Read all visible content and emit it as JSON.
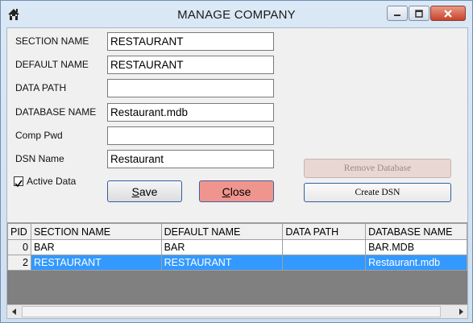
{
  "window": {
    "title": "MANAGE COMPANY",
    "icon": "house-icon"
  },
  "form": {
    "section_name": {
      "label": "SECTION NAME",
      "value": "RESTAURANT"
    },
    "default_name": {
      "label": "DEFAULT NAME",
      "value": "RESTAURANT"
    },
    "data_path": {
      "label": "DATA PATH",
      "value": ""
    },
    "database_name": {
      "label": "DATABASE NAME",
      "value": "Restaurant.mdb"
    },
    "comp_pwd": {
      "label": "Comp Pwd",
      "value": ""
    },
    "dsn_name": {
      "label": "DSN Name",
      "value": "Restaurant"
    },
    "active_data": {
      "label": "Active Data",
      "checked": true
    }
  },
  "buttons": {
    "save": {
      "label_first": "S",
      "label_rest": "ave"
    },
    "close": {
      "label_first": "C",
      "label_rest": "lose"
    },
    "remove_database": "Remove Database",
    "create_dsn": "Create DSN"
  },
  "grid": {
    "columns": [
      "PID",
      "SECTION NAME",
      "DEFAULT NAME",
      "DATA PATH",
      "DATABASE NAME"
    ],
    "rows": [
      {
        "pid": "0",
        "section": "BAR",
        "default": "BAR",
        "path": "",
        "db": "BAR.MDB",
        "selected": false
      },
      {
        "pid": "2",
        "section": "RESTAURANT",
        "default": "RESTAURANT",
        "path": "",
        "db": "Restaurant.mdb",
        "selected": true
      }
    ]
  },
  "colors": {
    "selection": "#3399ff",
    "close_button": "#f0958e",
    "grid_background": "#808080"
  }
}
